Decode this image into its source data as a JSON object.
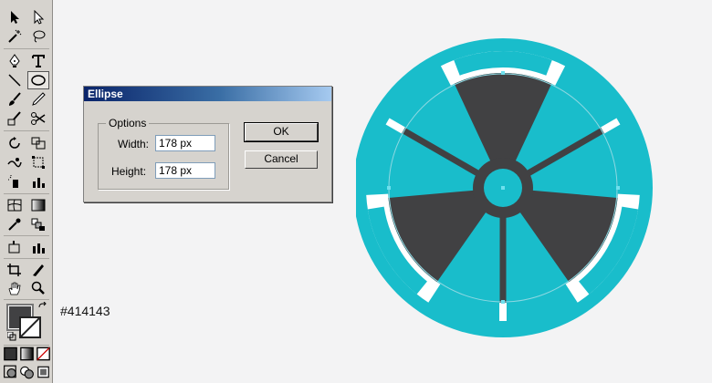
{
  "canvas": {
    "background": "#f3f3f4"
  },
  "toolbox": {
    "tools": [
      "selection-tool",
      "direct-selection-tool",
      "magic-wand-tool",
      "lasso-tool",
      "pen-tool",
      "type-tool",
      "line-tool",
      "ellipse-tool",
      "paintbrush-tool",
      "pencil-tool",
      "blob-brush-tool",
      "scissors-tool",
      "rotate-tool",
      "scale-tool",
      "warp-tool",
      "free-transform-tool",
      "symbol-sprayer-tool",
      "graph-tool",
      "mesh-tool",
      "gradient-tool",
      "eyedropper-tool",
      "blend-tool",
      "slice-tool",
      "artboard-tool",
      "hand-tool",
      "zoom-tool"
    ],
    "active_tool": "ellipse-tool",
    "fill_color": "#414143",
    "stroke_color": "#ffffff"
  },
  "color_readout": "#414143",
  "dialog": {
    "title": "Ellipse",
    "options_label": "Options",
    "width_label": "Width:",
    "width_value": "178 px",
    "height_label": "Height:",
    "height_value": "178 px",
    "ok_label": "OK",
    "cancel_label": "Cancel"
  },
  "artwork": {
    "ring_color": "#19bdcb",
    "blade_color": "#414143",
    "accent_color": "#ffffff",
    "guide_color": "#8ed8e2"
  }
}
